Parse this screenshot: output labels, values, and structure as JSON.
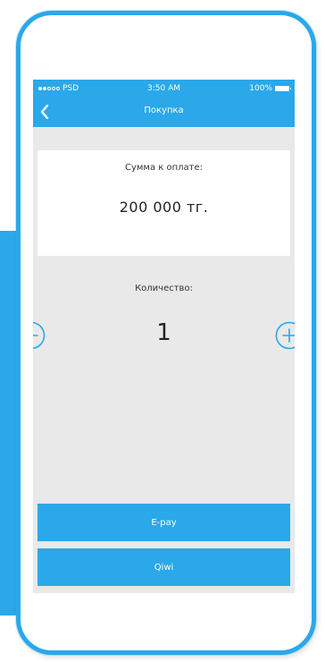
{
  "statusbar": {
    "carrier": "PSD",
    "time": "3:50 AM",
    "battery": "100%",
    "signal_full": 2,
    "signal_total": 5
  },
  "navbar": {
    "title": "Покупка",
    "back_icon": "chevron-left-icon"
  },
  "amount": {
    "label": "Сумма к оплате:",
    "value": "200 000 тг."
  },
  "quantity": {
    "label": "Количество:",
    "value": "1",
    "minus_icon": "minus-circle-icon",
    "plus_icon": "plus-circle-icon"
  },
  "payment": {
    "epay_label": "E-pay",
    "qiwi_label": "Qiwi"
  },
  "colors": {
    "accent": "#2aa8ea",
    "screen_bg": "#e9e9e9",
    "card_bg": "#ffffff"
  }
}
